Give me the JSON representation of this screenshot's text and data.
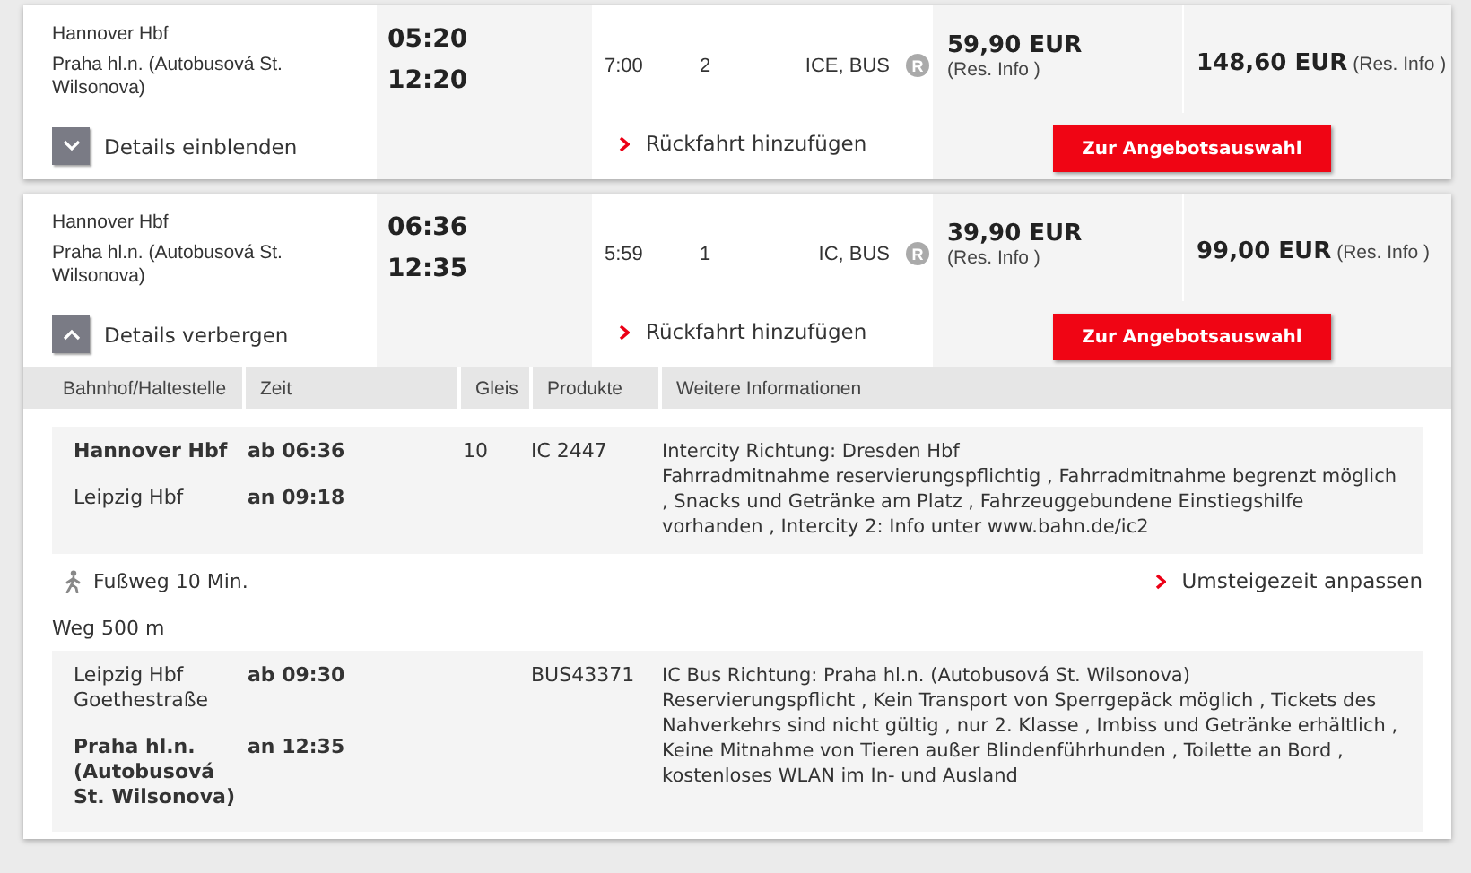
{
  "connections": [
    {
      "from": "Hannover Hbf",
      "to": "Praha hl.n. (Autobusová St. Wilsonova)",
      "departure": "05:20",
      "arrival": "12:20",
      "duration": "7:00",
      "changes": "2",
      "products": "ICE, BUS",
      "reservation_mark": "R",
      "price_1": "59,90 EUR",
      "price_1_note": "(Res. Info )",
      "price_2": "148,60 EUR",
      "price_2_note": "(Res. Info )",
      "details_toggle": {
        "label": "Details einblenden",
        "expanded": false
      },
      "return_link": "Rückfahrt hinzufügen",
      "offer_button": "Zur Angebotsauswahl"
    },
    {
      "from": "Hannover Hbf",
      "to": "Praha hl.n. (Autobusová St. Wilsonova)",
      "departure": "06:36",
      "arrival": "12:35",
      "duration": "5:59",
      "changes": "1",
      "products": "IC, BUS",
      "reservation_mark": "R",
      "price_1": "39,90 EUR",
      "price_1_note": "(Res. Info )",
      "price_2": "99,00 EUR",
      "price_2_note": "(Res. Info )",
      "details_toggle": {
        "label": "Details verbergen",
        "expanded": true
      },
      "return_link": "Rückfahrt hinzufügen",
      "offer_button": "Zur Angebotsauswahl",
      "details": {
        "columns": [
          "Bahnhof/Haltestelle",
          "Zeit",
          "Gleis",
          "Produkte",
          "Weitere Informationen"
        ],
        "items": [
          {
            "kind": "ride",
            "stops": [
              {
                "station": "Hannover Hbf",
                "time": "ab 06:36",
                "emphasized": true
              },
              {
                "station": "Leipzig Hbf",
                "time": "an 09:18",
                "emphasized": false
              }
            ],
            "platform": "10",
            "product": "IC 2447",
            "direction": "Intercity Richtung: Dresden Hbf",
            "attributes": "Fahrradmitnahme reservierungspflichtig , Fahrradmitnahme begrenzt möglich , Snacks und Getränke am Platz , Fahrzeuggebundene Einstiegshilfe vorhanden , Intercity 2: Info unter www.bahn.de/ic2"
          },
          {
            "kind": "walk",
            "label": "Fußweg 10 Min.",
            "link": "Umsteigezeit anpassen"
          },
          {
            "kind": "note",
            "text": "Weg 500 m"
          },
          {
            "kind": "ride",
            "stops": [
              {
                "station": "Leipzig Hbf Goethestraße",
                "time": "ab 09:30",
                "emphasized": false
              },
              {
                "station": "Praha hl.n. (Autobusová St. Wilsonova)",
                "time": "an 12:35",
                "emphasized": true
              }
            ],
            "product": "BUS43371",
            "direction": "IC Bus Richtung: Praha hl.n. (Autobusová St. Wilsonova)",
            "attributes": "Reservierungspflicht , Kein Transport von Sperrgepäck möglich , Tickets des Nahverkehrs sind nicht gültig , nur 2. Klasse , Imbiss und Getränke erhältlich , Keine Mitnahme von Tieren außer Blindenführhunden , Toilette an Bord , kostenloses WLAN im In- und Ausland"
          }
        ]
      }
    }
  ]
}
